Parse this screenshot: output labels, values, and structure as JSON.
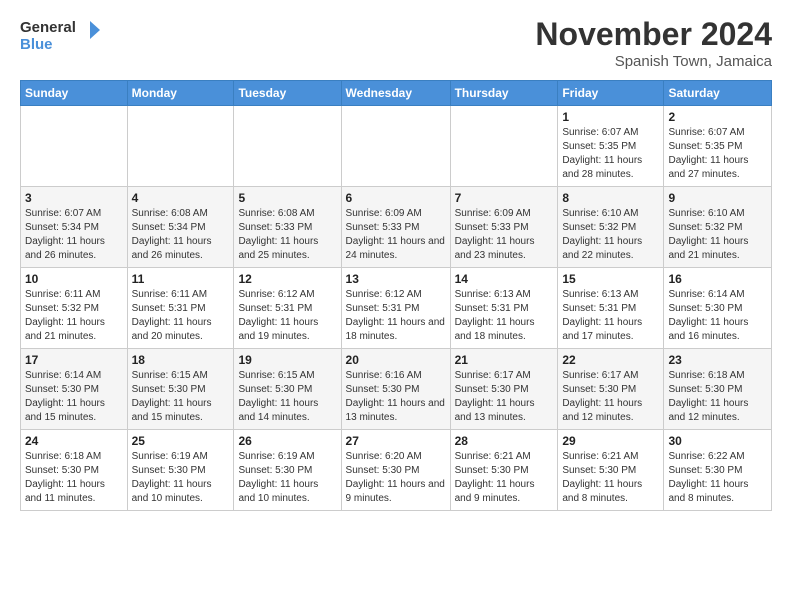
{
  "logo": {
    "line1": "General",
    "line2": "Blue"
  },
  "title": "November 2024",
  "subtitle": "Spanish Town, Jamaica",
  "days_of_week": [
    "Sunday",
    "Monday",
    "Tuesday",
    "Wednesday",
    "Thursday",
    "Friday",
    "Saturday"
  ],
  "weeks": [
    [
      {
        "day": "",
        "info": ""
      },
      {
        "day": "",
        "info": ""
      },
      {
        "day": "",
        "info": ""
      },
      {
        "day": "",
        "info": ""
      },
      {
        "day": "",
        "info": ""
      },
      {
        "day": "1",
        "info": "Sunrise: 6:07 AM\nSunset: 5:35 PM\nDaylight: 11 hours and 28 minutes."
      },
      {
        "day": "2",
        "info": "Sunrise: 6:07 AM\nSunset: 5:35 PM\nDaylight: 11 hours and 27 minutes."
      }
    ],
    [
      {
        "day": "3",
        "info": "Sunrise: 6:07 AM\nSunset: 5:34 PM\nDaylight: 11 hours and 26 minutes."
      },
      {
        "day": "4",
        "info": "Sunrise: 6:08 AM\nSunset: 5:34 PM\nDaylight: 11 hours and 26 minutes."
      },
      {
        "day": "5",
        "info": "Sunrise: 6:08 AM\nSunset: 5:33 PM\nDaylight: 11 hours and 25 minutes."
      },
      {
        "day": "6",
        "info": "Sunrise: 6:09 AM\nSunset: 5:33 PM\nDaylight: 11 hours and 24 minutes."
      },
      {
        "day": "7",
        "info": "Sunrise: 6:09 AM\nSunset: 5:33 PM\nDaylight: 11 hours and 23 minutes."
      },
      {
        "day": "8",
        "info": "Sunrise: 6:10 AM\nSunset: 5:32 PM\nDaylight: 11 hours and 22 minutes."
      },
      {
        "day": "9",
        "info": "Sunrise: 6:10 AM\nSunset: 5:32 PM\nDaylight: 11 hours and 21 minutes."
      }
    ],
    [
      {
        "day": "10",
        "info": "Sunrise: 6:11 AM\nSunset: 5:32 PM\nDaylight: 11 hours and 21 minutes."
      },
      {
        "day": "11",
        "info": "Sunrise: 6:11 AM\nSunset: 5:31 PM\nDaylight: 11 hours and 20 minutes."
      },
      {
        "day": "12",
        "info": "Sunrise: 6:12 AM\nSunset: 5:31 PM\nDaylight: 11 hours and 19 minutes."
      },
      {
        "day": "13",
        "info": "Sunrise: 6:12 AM\nSunset: 5:31 PM\nDaylight: 11 hours and 18 minutes."
      },
      {
        "day": "14",
        "info": "Sunrise: 6:13 AM\nSunset: 5:31 PM\nDaylight: 11 hours and 18 minutes."
      },
      {
        "day": "15",
        "info": "Sunrise: 6:13 AM\nSunset: 5:31 PM\nDaylight: 11 hours and 17 minutes."
      },
      {
        "day": "16",
        "info": "Sunrise: 6:14 AM\nSunset: 5:30 PM\nDaylight: 11 hours and 16 minutes."
      }
    ],
    [
      {
        "day": "17",
        "info": "Sunrise: 6:14 AM\nSunset: 5:30 PM\nDaylight: 11 hours and 15 minutes."
      },
      {
        "day": "18",
        "info": "Sunrise: 6:15 AM\nSunset: 5:30 PM\nDaylight: 11 hours and 15 minutes."
      },
      {
        "day": "19",
        "info": "Sunrise: 6:15 AM\nSunset: 5:30 PM\nDaylight: 11 hours and 14 minutes."
      },
      {
        "day": "20",
        "info": "Sunrise: 6:16 AM\nSunset: 5:30 PM\nDaylight: 11 hours and 13 minutes."
      },
      {
        "day": "21",
        "info": "Sunrise: 6:17 AM\nSunset: 5:30 PM\nDaylight: 11 hours and 13 minutes."
      },
      {
        "day": "22",
        "info": "Sunrise: 6:17 AM\nSunset: 5:30 PM\nDaylight: 11 hours and 12 minutes."
      },
      {
        "day": "23",
        "info": "Sunrise: 6:18 AM\nSunset: 5:30 PM\nDaylight: 11 hours and 12 minutes."
      }
    ],
    [
      {
        "day": "24",
        "info": "Sunrise: 6:18 AM\nSunset: 5:30 PM\nDaylight: 11 hours and 11 minutes."
      },
      {
        "day": "25",
        "info": "Sunrise: 6:19 AM\nSunset: 5:30 PM\nDaylight: 11 hours and 10 minutes."
      },
      {
        "day": "26",
        "info": "Sunrise: 6:19 AM\nSunset: 5:30 PM\nDaylight: 11 hours and 10 minutes."
      },
      {
        "day": "27",
        "info": "Sunrise: 6:20 AM\nSunset: 5:30 PM\nDaylight: 11 hours and 9 minutes."
      },
      {
        "day": "28",
        "info": "Sunrise: 6:21 AM\nSunset: 5:30 PM\nDaylight: 11 hours and 9 minutes."
      },
      {
        "day": "29",
        "info": "Sunrise: 6:21 AM\nSunset: 5:30 PM\nDaylight: 11 hours and 8 minutes."
      },
      {
        "day": "30",
        "info": "Sunrise: 6:22 AM\nSunset: 5:30 PM\nDaylight: 11 hours and 8 minutes."
      }
    ]
  ]
}
